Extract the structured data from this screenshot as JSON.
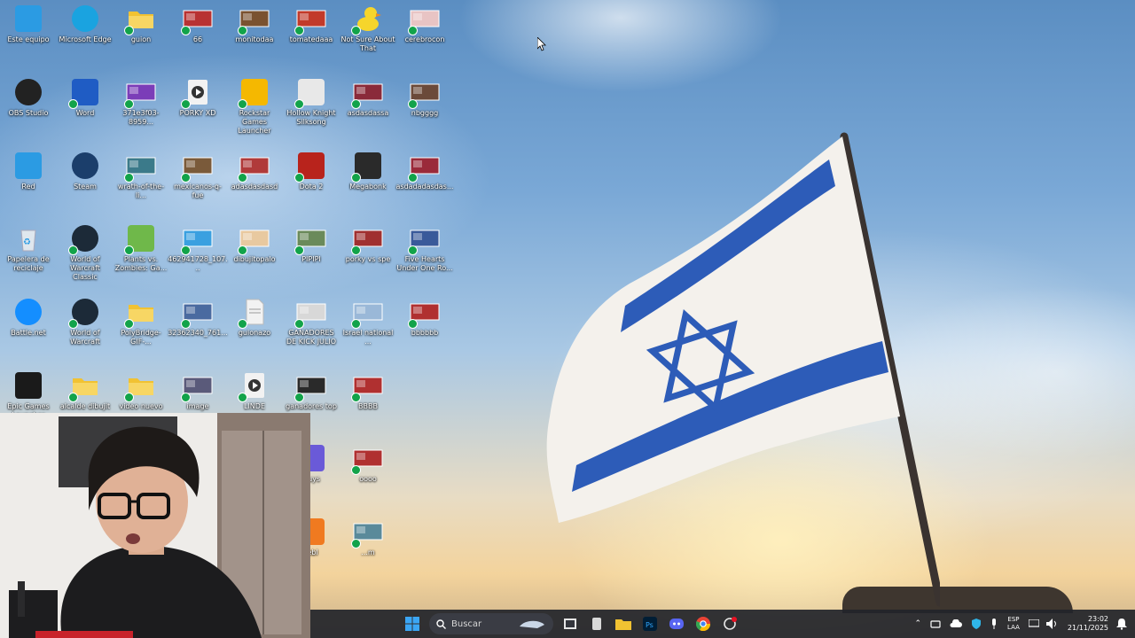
{
  "desktop": {
    "icons": [
      {
        "label": "Este equipo",
        "icon": "computer-icon",
        "color": "#2b9be3"
      },
      {
        "label": "Microsoft Edge",
        "icon": "edge-icon",
        "color": "#1aa3e0"
      },
      {
        "label": "guion",
        "icon": "folder-icon",
        "color": "#f1c232"
      },
      {
        "label": "66",
        "icon": "image-thumbnail-icon",
        "color": "#b83232"
      },
      {
        "label": "monitodaa",
        "icon": "image-thumbnail-icon",
        "color": "#7a5230"
      },
      {
        "label": "tomatedaaa",
        "icon": "image-thumbnail-icon",
        "color": "#c23a2a"
      },
      {
        "label": "Not Sure About That",
        "icon": "duck-icon",
        "color": "#f6d52b"
      },
      {
        "label": "cerebrocon",
        "icon": "image-thumbnail-icon",
        "color": "#e8c4c4"
      },
      {
        "label": "OBS Studio",
        "icon": "obs-icon",
        "color": "#222222"
      },
      {
        "label": "Word",
        "icon": "word-icon",
        "color": "#1f5cc4"
      },
      {
        "label": "371e3f03-8959...",
        "icon": "image-thumbnail-icon",
        "color": "#7b3db8"
      },
      {
        "label": "PORKY XD",
        "icon": "video-play-icon",
        "color": "#f2f2f2"
      },
      {
        "label": "Rockstar Games Launcher",
        "icon": "rockstar-icon",
        "color": "#f5b800"
      },
      {
        "label": "Hollow Knight Silksong",
        "icon": "hollow-knight-icon",
        "color": "#e8e8e8"
      },
      {
        "label": "asdasdassa",
        "icon": "image-thumbnail-icon",
        "color": "#8a2a3a"
      },
      {
        "label": "nbgggg",
        "icon": "image-thumbnail-icon",
        "color": "#6b4a3a"
      },
      {
        "label": "Red",
        "icon": "network-icon",
        "color": "#2b9be3"
      },
      {
        "label": "Steam",
        "icon": "steam-icon",
        "color": "#1b3e6b"
      },
      {
        "label": "wrath-of-the-li...",
        "icon": "image-thumbnail-icon",
        "color": "#3b7a8a"
      },
      {
        "label": "mexicanos-q-fue",
        "icon": "image-thumbnail-icon",
        "color": "#7a5a3a"
      },
      {
        "label": "adasdasdasd",
        "icon": "image-thumbnail-icon",
        "color": "#b03a3a"
      },
      {
        "label": "Dota 2",
        "icon": "dota-icon",
        "color": "#b8231c"
      },
      {
        "label": "Megabonk",
        "icon": "megabonk-icon",
        "color": "#2a2a2a"
      },
      {
        "label": "asdadadasdas...",
        "icon": "image-thumbnail-icon",
        "color": "#9a2a3a"
      },
      {
        "label": "Papelera de reciclaje",
        "icon": "recycle-bin-icon",
        "color": "#dfe7ee"
      },
      {
        "label": "World of Warcraft Classic",
        "icon": "wow-icon",
        "color": "#1c2a38"
      },
      {
        "label": "Plants vs. Zombies: Ga...",
        "icon": "pvz-icon",
        "color": "#6fb84a"
      },
      {
        "label": "462941728_107...",
        "icon": "image-thumbnail-icon",
        "color": "#3aa0e0"
      },
      {
        "label": "dibujitopalo",
        "icon": "image-thumbnail-icon",
        "color": "#e8c9a0"
      },
      {
        "label": "PIPIPI",
        "icon": "image-thumbnail-icon",
        "color": "#6a8a5a"
      },
      {
        "label": "porky vs spe",
        "icon": "image-thumbnail-icon",
        "color": "#a03030"
      },
      {
        "label": "Five Hearts Under One Ro...",
        "icon": "image-thumbnail-icon",
        "color": "#3a5a9a"
      },
      {
        "label": "Battle.net",
        "icon": "battlenet-icon",
        "color": "#148eff"
      },
      {
        "label": "World of Warcraft",
        "icon": "wow-icon",
        "color": "#1c2a38"
      },
      {
        "label": "PolyBridge-GIF-...",
        "icon": "folder-icon",
        "color": "#f1c232"
      },
      {
        "label": "32362340_761...",
        "icon": "image-thumbnail-icon",
        "color": "#4a6aa0"
      },
      {
        "label": "guionazo",
        "icon": "document-icon",
        "color": "#f2f2f2"
      },
      {
        "label": "GANADORES DE KICK JULIO",
        "icon": "image-thumbnail-icon",
        "color": "#d8d8d8"
      },
      {
        "label": "Israel national ...",
        "icon": "image-thumbnail-icon",
        "color": "#9ab8d8"
      },
      {
        "label": "bbbbbb",
        "icon": "image-thumbnail-icon",
        "color": "#b03030"
      },
      {
        "label": "Epic Games Launcher",
        "icon": "epic-icon",
        "color": "#1a1a1a"
      },
      {
        "label": "alcalde dibujit",
        "icon": "folder-icon",
        "color": "#f1c232"
      },
      {
        "label": "video nuevo",
        "icon": "folder-icon",
        "color": "#f1c232"
      },
      {
        "label": "image",
        "icon": "image-thumbnail-icon",
        "color": "#5a5a7a"
      },
      {
        "label": "LINDE",
        "icon": "video-play-icon",
        "color": "#f2f2f2"
      },
      {
        "label": "ganadores top",
        "icon": "image-thumbnail-icon",
        "color": "#2a2a2a"
      },
      {
        "label": "BBBB",
        "icon": "image-thumbnail-icon",
        "color": "#b03030"
      },
      {
        "label": "Guys",
        "icon": "fall-guys-icon",
        "color": "#6a5ad8"
      },
      {
        "label": "oooo",
        "icon": "image-thumbnail-icon",
        "color": "#b03030"
      },
      {
        "label": "rebl",
        "icon": "app-icon",
        "color": "#f07a20"
      },
      {
        "label": "...m",
        "icon": "image-thumbnail-icon",
        "color": "#5a8a9a"
      }
    ]
  },
  "taskbar": {
    "search_placeholder": "Buscar",
    "apps": [
      {
        "name": "start",
        "icon": "windows-start-icon",
        "color": "#3ba6f5"
      },
      {
        "name": "task-view",
        "icon": "task-view-icon",
        "color": "#e6e6e6"
      },
      {
        "name": "unknown",
        "icon": "app-icon",
        "color": "#d9d9d9"
      },
      {
        "name": "file-explorer",
        "icon": "folder-icon",
        "color": "#f1c232"
      },
      {
        "name": "photoshop",
        "icon": "photoshop-icon",
        "color": "#31a8ff"
      },
      {
        "name": "discord",
        "icon": "discord-icon",
        "color": "#5865f2"
      },
      {
        "name": "chrome",
        "icon": "chrome-icon",
        "color": "#ea4335"
      },
      {
        "name": "settings-app",
        "icon": "app-icon",
        "color": "#e6e6e6"
      }
    ],
    "tray": {
      "language_line1": "ESP",
      "language_line2": "LAA",
      "time": "23:02",
      "date": "21/11/2025"
    }
  }
}
